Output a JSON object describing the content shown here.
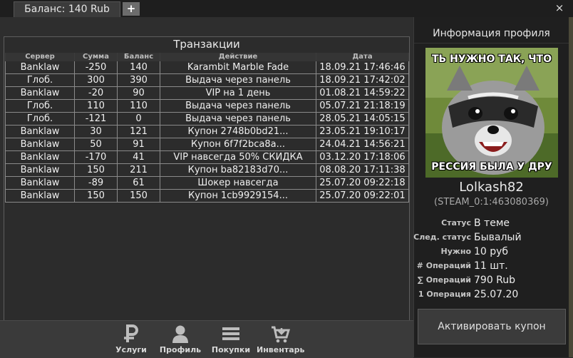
{
  "tabs": {
    "balance_label": "Баланс: 140 Rub",
    "add_label": "+"
  },
  "window": {
    "close_label": "×"
  },
  "transactions": {
    "title": "Транзакции",
    "columns": [
      "Сервер",
      "Сумма",
      "Баланс",
      "Действие",
      "Дата"
    ],
    "rows": [
      [
        "Banklaw",
        "-250",
        "140",
        "Karambit Marble Fade",
        "18.09.21 17:46:46"
      ],
      [
        "Глоб.",
        "300",
        "390",
        "Выдача через панель",
        "18.09.21 17:42:02"
      ],
      [
        "Banklaw",
        "-20",
        "90",
        "VIP на 1 день",
        "01.08.21 14:59:22"
      ],
      [
        "Глоб.",
        "110",
        "110",
        "Выдача через панель",
        "05.07.21 21:18:19"
      ],
      [
        "Глоб.",
        "-121",
        "0",
        "Выдача через панель",
        "28.05.21 14:05:15"
      ],
      [
        "Banklaw",
        "30",
        "121",
        "Купон 2748b0bd21...",
        "23.05.21 19:10:17"
      ],
      [
        "Banklaw",
        "50",
        "91",
        "Купон 6f7f2bca8a...",
        "24.04.21 14:56:21"
      ],
      [
        "Banklaw",
        "-170",
        "41",
        "VIP навсегда 50% СКИДКА",
        "03.12.20 17:18:06"
      ],
      [
        "Banklaw",
        "150",
        "211",
        "Купон ba82183d70...",
        "08.08.20 17:11:38"
      ],
      [
        "Banklaw",
        "-89",
        "61",
        "Шокер навсегда",
        "25.07.20 09:22:18"
      ],
      [
        "Banklaw",
        "150",
        "150",
        "Купон 1cb9929154...",
        "25.07.20 09:22:01"
      ]
    ]
  },
  "nav": {
    "services": {
      "label": "Услуги",
      "icon": "ruble-icon"
    },
    "profile": {
      "label": "Профиль",
      "icon": "user-icon"
    },
    "purchases": {
      "label": "Покупки",
      "icon": "list-icon"
    },
    "inventory": {
      "label": "Инвентарь",
      "icon": "cart-icon"
    }
  },
  "profile": {
    "header": "Информация профиля",
    "avatar_top_text": "ТЬ НУЖНО ТАК, ЧТО",
    "avatar_bottom_text": "РЕССИЯ БЫЛА У ДРУ",
    "username": "Lolkash82",
    "steam_id": "(STEAM_0:1:463080369)",
    "stats": [
      {
        "label": "Статус",
        "value": "В теме"
      },
      {
        "label": "След. статус",
        "value": "Бывалый"
      },
      {
        "label": "Нужно",
        "value": "10 руб"
      },
      {
        "label": "# Операций",
        "value": "11 шт."
      },
      {
        "label": "∑ Операций",
        "value": "790 Rub"
      },
      {
        "label": "1 Операция",
        "value": "25.07.20"
      }
    ],
    "coupon_button": "Активировать купон"
  },
  "colors": {
    "background": "#2b2b2b",
    "panel_dark": "#1f1f1f",
    "tab_add": "#6c6c6c",
    "table_line": "#8a8a8a",
    "avatar_bg": "#5a7a2e"
  }
}
